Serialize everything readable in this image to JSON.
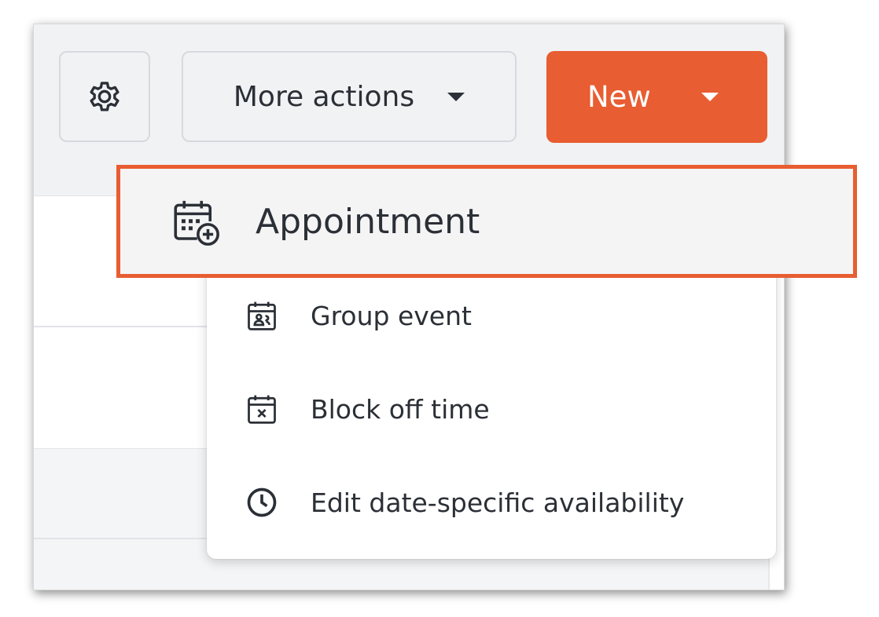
{
  "toolbar": {
    "settings_icon": "gear-icon",
    "more_actions_label": "More actions",
    "new_label": "New"
  },
  "colors": {
    "accent": "#e85d31",
    "toolbar_bg": "#f1f2f4",
    "text": "#2b2f36"
  },
  "dropdown": {
    "highlighted": {
      "label": "Appointment",
      "icon": "calendar-add-icon"
    },
    "items": [
      {
        "label": "Group event",
        "icon": "calendar-group-icon"
      },
      {
        "label": "Block off time",
        "icon": "calendar-x-icon"
      },
      {
        "label": "Edit date-specific availability",
        "icon": "clock-icon"
      }
    ]
  }
}
